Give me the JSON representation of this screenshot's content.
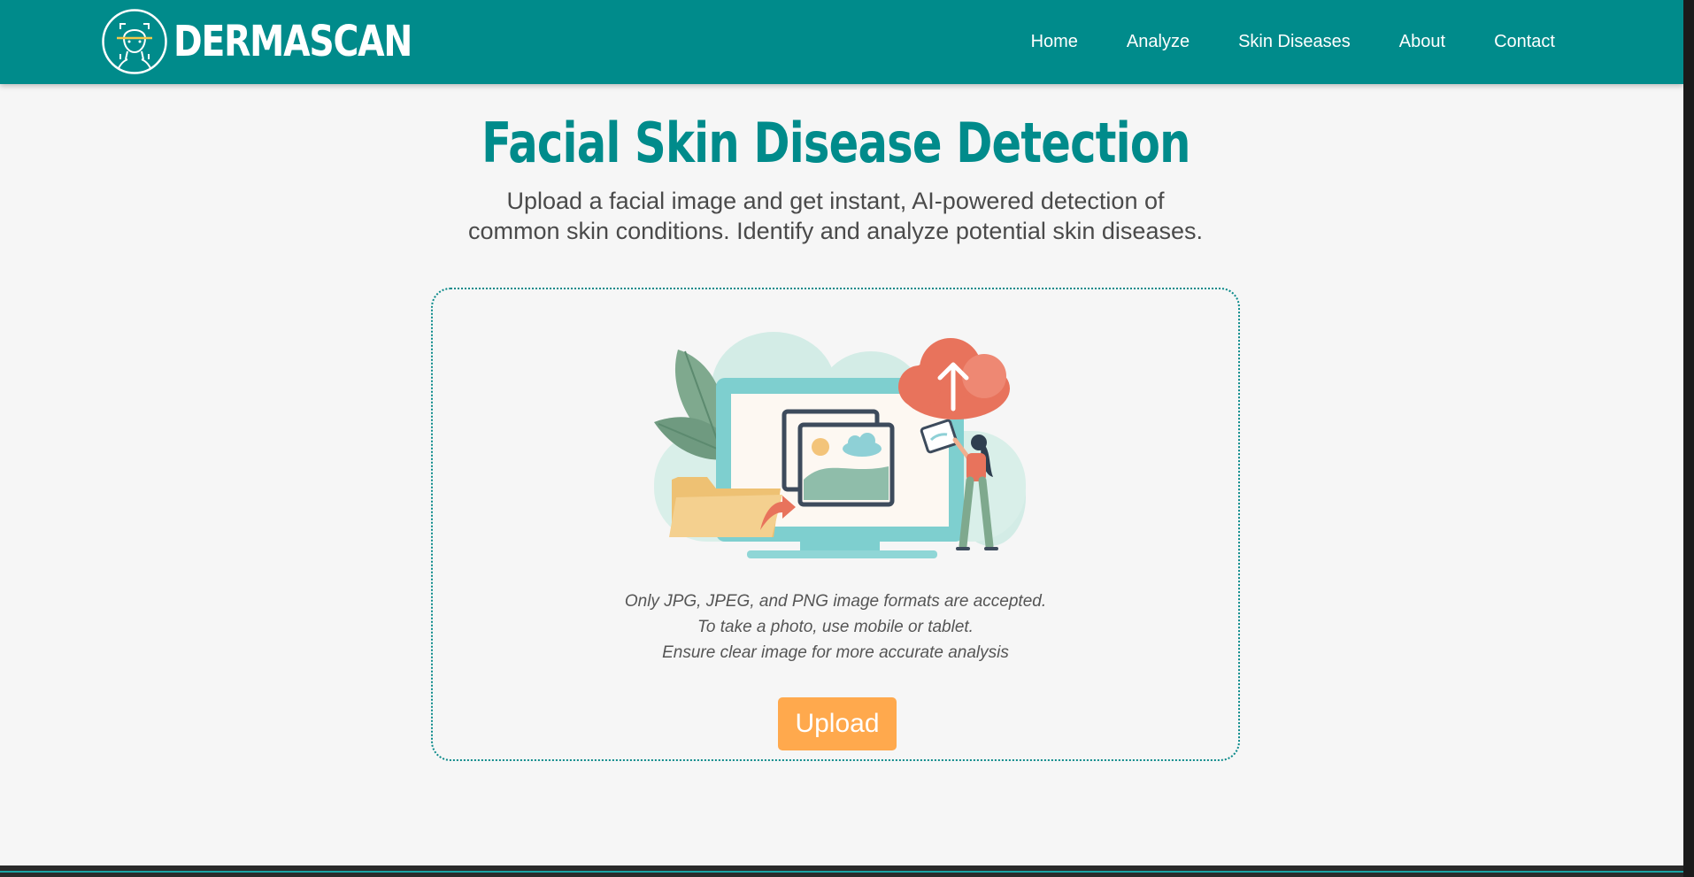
{
  "header": {
    "brand_name": "DERMASCAN",
    "logo_icon": "face-scan-icon",
    "nav": [
      {
        "label": "Home"
      },
      {
        "label": "Analyze"
      },
      {
        "label": "Skin Diseases"
      },
      {
        "label": "About"
      },
      {
        "label": "Contact"
      }
    ]
  },
  "main": {
    "title": "Facial Skin Disease Detection",
    "subtitle": "Upload a facial image and get instant, AI-powered detection of common skin conditions. Identify and analyze potential skin diseases.",
    "upload": {
      "illustration_icon": "upload-illustration-icon",
      "hints": [
        "Only JPG, JPEG, and PNG image formats are accepted.",
        "To take a photo, use mobile or tablet.",
        "Ensure clear image for more accurate analysis"
      ],
      "button_label": "Upload"
    }
  },
  "colors": {
    "primary": "#008b8b",
    "accent": "#ffa94d",
    "background": "#f6f6f6",
    "text": "#4a4a4a"
  }
}
